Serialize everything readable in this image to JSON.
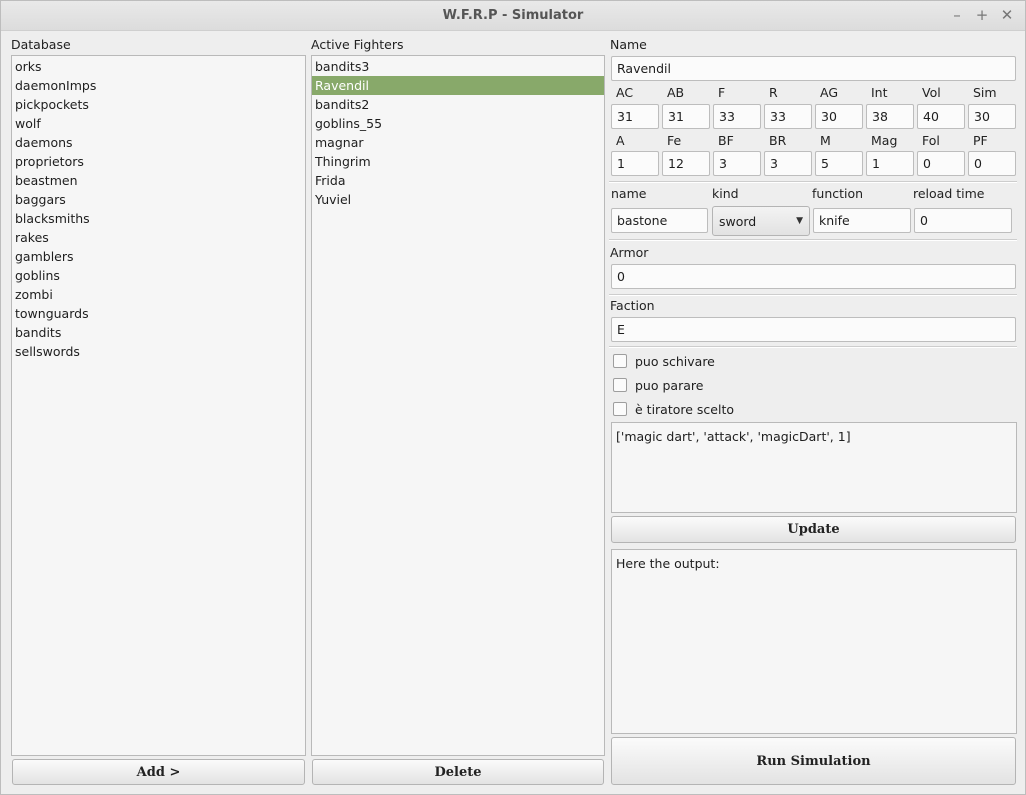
{
  "window": {
    "title": "W.F.R.P - Simulator",
    "minimize": "–",
    "maximize": "+",
    "close": "✕"
  },
  "database": {
    "label": "Database",
    "items": [
      "orks",
      "daemonImps",
      "pickpockets",
      "wolf",
      "daemons",
      "proprietors",
      "beastmen",
      "baggars",
      "blacksmiths",
      "rakes",
      "gamblers",
      "goblins",
      "zombi",
      "townguards",
      "bandits",
      "sellswords"
    ],
    "add_label": "Add >"
  },
  "active": {
    "label": "Active Fighters",
    "items": [
      "bandits3",
      "Ravendil",
      "bandits2",
      "goblins_55",
      "magnar",
      "Thingrim",
      "Frida",
      "Yuviel"
    ],
    "selected_index": 1,
    "delete_label": "Delete"
  },
  "editor": {
    "name_label": "Name",
    "name_value": "Ravendil",
    "stats_row1": [
      {
        "label": "AC",
        "value": "31"
      },
      {
        "label": "AB",
        "value": "31"
      },
      {
        "label": "F",
        "value": "33"
      },
      {
        "label": "R",
        "value": "33"
      },
      {
        "label": "AG",
        "value": "30"
      },
      {
        "label": "Int",
        "value": "38"
      },
      {
        "label": "Vol",
        "value": "40"
      },
      {
        "label": "Sim",
        "value": "30"
      }
    ],
    "stats_row2": [
      {
        "label": "A",
        "value": "1"
      },
      {
        "label": "Fe",
        "value": "12"
      },
      {
        "label": "BF",
        "value": "3"
      },
      {
        "label": "BR",
        "value": "3"
      },
      {
        "label": "M",
        "value": "5"
      },
      {
        "label": "Mag",
        "value": "1"
      },
      {
        "label": "Fol",
        "value": "0"
      },
      {
        "label": "PF",
        "value": "0"
      }
    ],
    "weapon": {
      "name_label": "name",
      "kind_label": "kind",
      "function_label": "function",
      "reload_label": "reload time",
      "name_value": "bastone",
      "kind_value": "sword",
      "function_value": "knife",
      "reload_value": "0"
    },
    "armor_label": "Armor",
    "armor_value": "0",
    "faction_label": "Faction",
    "faction_value": "E",
    "checks": [
      {
        "label": "puo schivare",
        "checked": false
      },
      {
        "label": "puo parare",
        "checked": false
      },
      {
        "label": "è tiratore scelto",
        "checked": false
      }
    ],
    "spells_text": "['magic dart', 'attack', 'magicDart', 1]",
    "update_label": "Update",
    "output_text": "Here the output:",
    "run_label": "Run Simulation"
  }
}
